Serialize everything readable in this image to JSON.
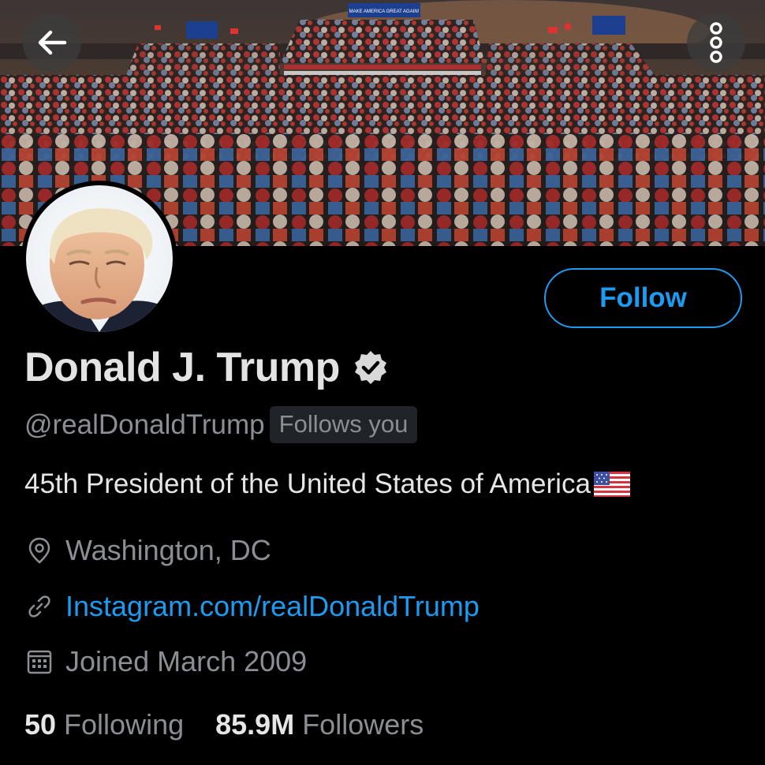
{
  "profile": {
    "display_name": "Donald J. Trump",
    "handle": "@realDonaldTrump",
    "follows_you_badge": "Follows you",
    "bio": "45th President of the United States of America",
    "location": "Washington, DC",
    "website": "Instagram.com/realDonaldTrump",
    "joined": "Joined March 2009",
    "following_count": "50",
    "following_label": "Following",
    "followers_count": "85.9M",
    "followers_label": "Followers"
  },
  "actions": {
    "follow_label": "Follow"
  },
  "banner": {
    "sign_main": "MAKE AMERICA GREAT AGAIN!",
    "sign_small": "MAKE AMERICA GREAT AGAIN"
  },
  "icons": {
    "back": "arrow-left-icon",
    "more": "more-vertical-icon",
    "verified": "verified-badge-icon",
    "flag": "us-flag-emoji",
    "location": "location-pin-icon",
    "link": "link-icon",
    "calendar": "calendar-icon"
  },
  "colors": {
    "background": "#000000",
    "accent": "#1d9bf0",
    "primary_text": "#e3e3e3",
    "secondary_text": "#8b8e92",
    "badge_bg": "#202327"
  }
}
